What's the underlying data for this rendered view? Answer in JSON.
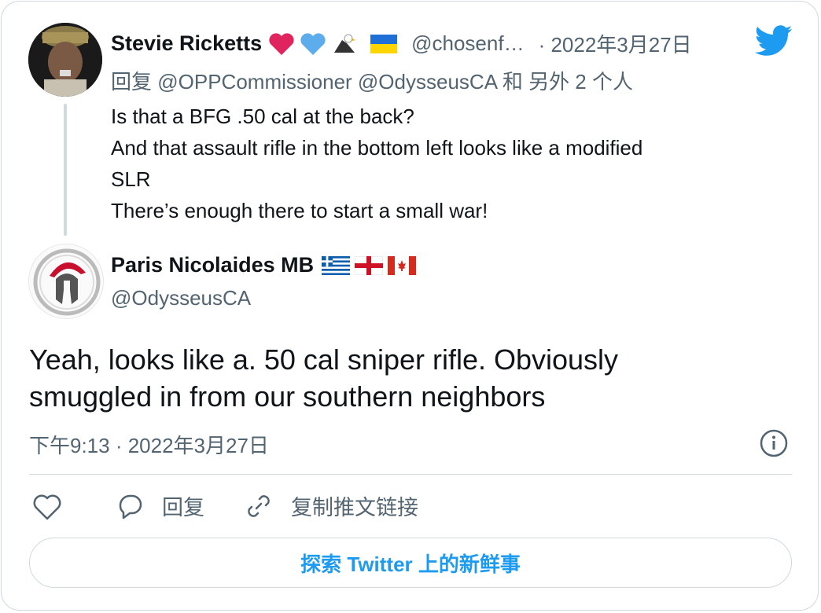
{
  "quoted": {
    "author_name": "Stevie Ricketts",
    "author_handle": "@chosenf…",
    "date": "· 2022年3月27日",
    "reply_prefix": "回复",
    "reply_mentions": "@OPPCommissioner @OdysseusCA",
    "reply_suffix": "和 另外 2 个人",
    "text_lines": [
      "Is that a BFG .50 cal at the back?",
      "And that assault rifle in the bottom left looks like a modified",
      "SLR",
      "There’s enough there to start a small war!"
    ]
  },
  "tweet": {
    "author_name": "Paris Nicolaides MB",
    "author_handle": "@OdysseusCA",
    "text_line1": "Yeah, looks like a. 50 cal sniper rifle. Obviously",
    "text_line2": "smuggled in from our southern neighbors",
    "timestamp": "下午9:13 · 2022年3月27日"
  },
  "actions": {
    "reply_label": "回复",
    "copy_link_label": "复制推文链接"
  },
  "cta_label": "探索 Twitter 上的新鲜事",
  "colors": {
    "twitter_blue": "#1d9bf0",
    "text_primary": "#0f1419",
    "text_secondary": "#536471",
    "border": "#cfd9de"
  },
  "icons": {
    "twitter": "twitter-bird-icon",
    "info": "info-icon",
    "like": "heart-icon",
    "reply": "speech-bubble-icon",
    "link": "link-icon"
  }
}
